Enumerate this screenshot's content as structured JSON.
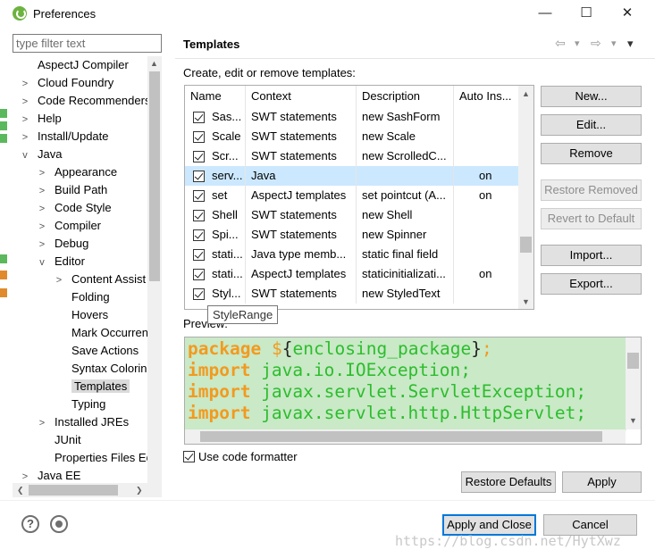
{
  "window": {
    "title": "Preferences",
    "controls": {
      "minimize": "—",
      "maximize": "☐",
      "close": "✕"
    }
  },
  "filter": {
    "placeholder": "type filter text"
  },
  "tree": {
    "items": [
      {
        "label": "AspectJ Compiler",
        "chevron": ""
      },
      {
        "label": "Cloud Foundry",
        "chevron": ">"
      },
      {
        "label": "Code Recommenders",
        "chevron": ">"
      },
      {
        "label": "Help",
        "chevron": ">"
      },
      {
        "label": "Install/Update",
        "chevron": ">"
      },
      {
        "label": "Java",
        "chevron": "v"
      },
      {
        "label": "Appearance",
        "chevron": ">"
      },
      {
        "label": "Build Path",
        "chevron": ">"
      },
      {
        "label": "Code Style",
        "chevron": ">"
      },
      {
        "label": "Compiler",
        "chevron": ">"
      },
      {
        "label": "Debug",
        "chevron": ">"
      },
      {
        "label": "Editor",
        "chevron": "v"
      },
      {
        "label": "Content Assist",
        "chevron": ">"
      },
      {
        "label": "Folding",
        "chevron": ""
      },
      {
        "label": "Hovers",
        "chevron": ""
      },
      {
        "label": "Mark Occurren",
        "chevron": ""
      },
      {
        "label": "Save Actions",
        "chevron": ""
      },
      {
        "label": "Syntax Coloring",
        "chevron": ""
      },
      {
        "label": "Templates",
        "chevron": ""
      },
      {
        "label": "Typing",
        "chevron": ""
      },
      {
        "label": "Installed JREs",
        "chevron": ">"
      },
      {
        "label": "JUnit",
        "chevron": ""
      },
      {
        "label": "Properties Files Ed",
        "chevron": ""
      },
      {
        "label": "Java EE",
        "chevron": ">"
      }
    ],
    "selected": "Templates"
  },
  "page": {
    "title": "Templates",
    "nav": {
      "back": "⇦",
      "back_menu": "▾",
      "forward": "⇨",
      "forward_menu": "▾",
      "menu": "▾"
    },
    "description": "Create, edit or remove templates:"
  },
  "table": {
    "columns": [
      "Name",
      "Context",
      "Description",
      "Auto Ins..."
    ],
    "rows": [
      {
        "name": "Sas...",
        "context": "SWT statements",
        "description": "new SashForm",
        "auto": "",
        "checked": true
      },
      {
        "name": "Scale",
        "context": "SWT statements",
        "description": "new Scale",
        "auto": "",
        "checked": true
      },
      {
        "name": "Scr...",
        "context": "SWT statements",
        "description": "new ScrolledC...",
        "auto": "",
        "checked": true
      },
      {
        "name": "serv...",
        "context": "Java",
        "description": "",
        "auto": "on",
        "checked": true,
        "selected": true
      },
      {
        "name": "set",
        "context": "AspectJ templates",
        "description": "set pointcut (A...",
        "auto": "on",
        "checked": true
      },
      {
        "name": "Shell",
        "context": "SWT statements",
        "description": "new Shell",
        "auto": "",
        "checked": true
      },
      {
        "name": "Spi...",
        "context": "SWT statements",
        "description": "new Spinner",
        "auto": "",
        "checked": true
      },
      {
        "name": "stati...",
        "context": "Java type memb...",
        "description": "static final field",
        "auto": "",
        "checked": true
      },
      {
        "name": "stati...",
        "context": "AspectJ templates",
        "description": "staticinitializati...",
        "auto": "on",
        "checked": true
      },
      {
        "name": "Styl...",
        "context": "SWT statements",
        "description": "new StyledText",
        "auto": "",
        "checked": true
      }
    ],
    "scroll_up": "▲",
    "scroll_down": "▼"
  },
  "tooltip": "StyleRange",
  "side_buttons": {
    "new": "New...",
    "edit": "Edit...",
    "remove": "Remove",
    "restore_removed": "Restore Removed",
    "revert_default": "Revert to Default",
    "import": "Import...",
    "export": "Export..."
  },
  "preview": {
    "label": "Preview:",
    "lines": [
      {
        "kw": "package",
        "rest": " ${enclosing_package};",
        "var": true
      },
      {
        "kw": "import",
        "rest": " java.io.IOException;"
      },
      {
        "kw": "import",
        "rest": " javax.servlet.ServletException;"
      },
      {
        "kw": "import",
        "rest": " javax.servlet.http.HttpServlet;"
      }
    ]
  },
  "formatter": {
    "label": "Use code formatter",
    "checked": true
  },
  "bottom": {
    "restore_defaults": "Restore Defaults",
    "apply": "Apply",
    "apply_close": "Apply and Close",
    "cancel": "Cancel",
    "help": "?",
    "watermark": "https://blog.csdn.net/HytXwz"
  },
  "colors": {
    "selection": "#cce8ff",
    "preview_bg": "#c9e9c7",
    "keyword": "#f29a1f",
    "identifier": "#2dbd2d",
    "default_button_border": "#0078d7"
  }
}
